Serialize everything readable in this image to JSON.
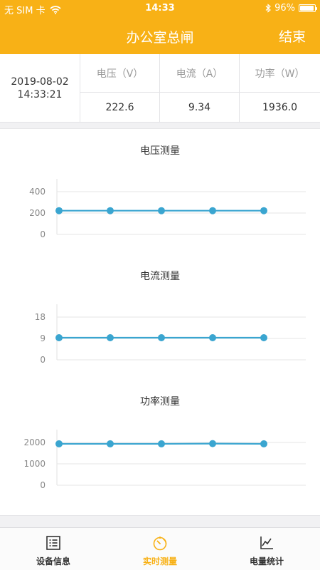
{
  "status_bar": {
    "carrier": "无 SIM 卡",
    "time": "14:33",
    "battery": "96%",
    "battery_level": 0.96,
    "icons": [
      "wifi-icon",
      "bluetooth-icon",
      "battery-icon"
    ]
  },
  "nav": {
    "title": "办公室总闸",
    "end_label": "结束"
  },
  "info": {
    "date": "2019-08-02",
    "time": "14:33:21",
    "columns": [
      {
        "header": "电压（V）",
        "value": "222.6"
      },
      {
        "header": "电流（A）",
        "value": "9.34"
      },
      {
        "header": "功率（W）",
        "value": "1936.0"
      }
    ]
  },
  "colors": {
    "brand": "#f8b116",
    "series": "#3aa5d0"
  },
  "chart_data": [
    {
      "type": "line",
      "title": "电压测量",
      "y_ticks": [
        "0",
        "200",
        "400"
      ],
      "ylim": [
        0,
        400
      ],
      "grid": true,
      "x": [
        1,
        2,
        3,
        4,
        5
      ],
      "values": [
        222,
        222,
        222,
        222,
        222
      ]
    },
    {
      "type": "line",
      "title": "电流测量",
      "y_ticks": [
        "0",
        "9",
        "18"
      ],
      "ylim": [
        0,
        18
      ],
      "grid": true,
      "x": [
        1,
        2,
        3,
        4,
        5
      ],
      "values": [
        9.3,
        9.3,
        9.3,
        9.3,
        9.3
      ]
    },
    {
      "type": "line",
      "title": "功率测量",
      "y_ticks": [
        "0",
        "1000",
        "2000"
      ],
      "ylim": [
        0,
        2000
      ],
      "grid": true,
      "x": [
        1,
        2,
        3,
        4,
        5
      ],
      "values": [
        1936,
        1936,
        1936,
        1945,
        1936
      ]
    }
  ],
  "tabs": [
    {
      "label": "设备信息",
      "icon": "list-icon",
      "active": false
    },
    {
      "label": "实时测量",
      "icon": "timer-icon",
      "active": true
    },
    {
      "label": "电量统计",
      "icon": "line-chart-icon",
      "active": false
    }
  ]
}
